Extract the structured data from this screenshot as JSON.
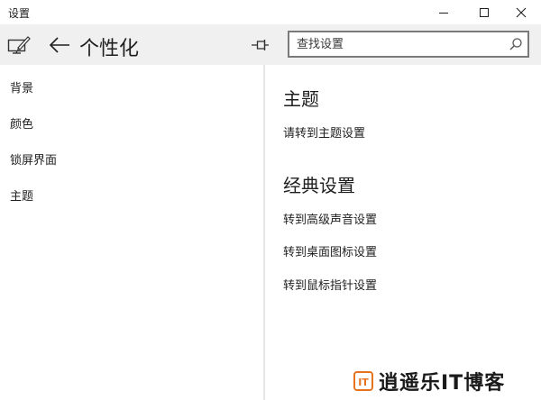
{
  "window": {
    "title": "设置"
  },
  "header": {
    "page_title": "个性化",
    "search_placeholder": "查找设置"
  },
  "sidebar": {
    "items": [
      {
        "label": "背景"
      },
      {
        "label": "颜色"
      },
      {
        "label": "锁屏界面"
      },
      {
        "label": "主题"
      }
    ]
  },
  "main": {
    "section1_title": "主题",
    "section1_link": "请转到主题设置",
    "section2_title": "经典设置",
    "links": [
      {
        "label": "转到高级声音设置"
      },
      {
        "label": "转到桌面图标设置"
      },
      {
        "label": "转到鼠标指针设置"
      }
    ]
  },
  "watermark": {
    "text": "逍遥乐IT博客"
  },
  "colors": {
    "header_bg": "#f0f0f0",
    "text": "#1f1f1f",
    "accent_orange": "#e8731e"
  }
}
